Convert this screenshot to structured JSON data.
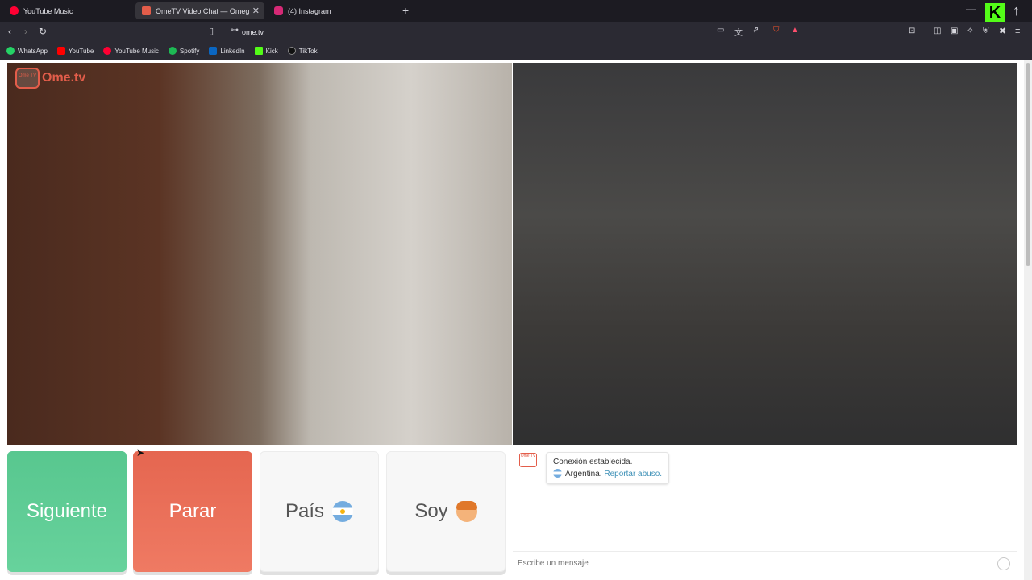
{
  "tabs": [
    {
      "title": "YouTube Music",
      "favicon_color": "#ff0033"
    },
    {
      "title": "OmeTV Video Chat — Omeg",
      "favicon_color": "#e35d4a",
      "active": true
    },
    {
      "title": "(4) Instagram",
      "favicon_color": "#d62976"
    }
  ],
  "toolbar": {
    "url": "ome.tv"
  },
  "bookmarks": [
    {
      "label": "WhatsApp",
      "color": "#25d366"
    },
    {
      "label": "YouTube",
      "color": "#ff0000"
    },
    {
      "label": "YouTube Music",
      "color": "#ff0033"
    },
    {
      "label": "Spotify",
      "color": "#1db954"
    },
    {
      "label": "LinkedIn",
      "color": "#0a66c2"
    },
    {
      "label": "Kick",
      "color": "#53fc18"
    },
    {
      "label": "TikTok",
      "color": "#111111"
    }
  ],
  "app": {
    "logo_text": "Ome.tv",
    "logo_badge": "Ome TV"
  },
  "buttons": {
    "next": "Siguiente",
    "stop": "Parar",
    "country": "País",
    "soy": "Soy"
  },
  "chat": {
    "status": "Conexión establecida.",
    "country": "Argentina.",
    "report": "Reportar abuso.",
    "input_placeholder": "Escribe un mensaje"
  },
  "colors": {
    "next": "#5fcd96",
    "stop": "#ea6f59",
    "link": "#3b8fb6"
  }
}
